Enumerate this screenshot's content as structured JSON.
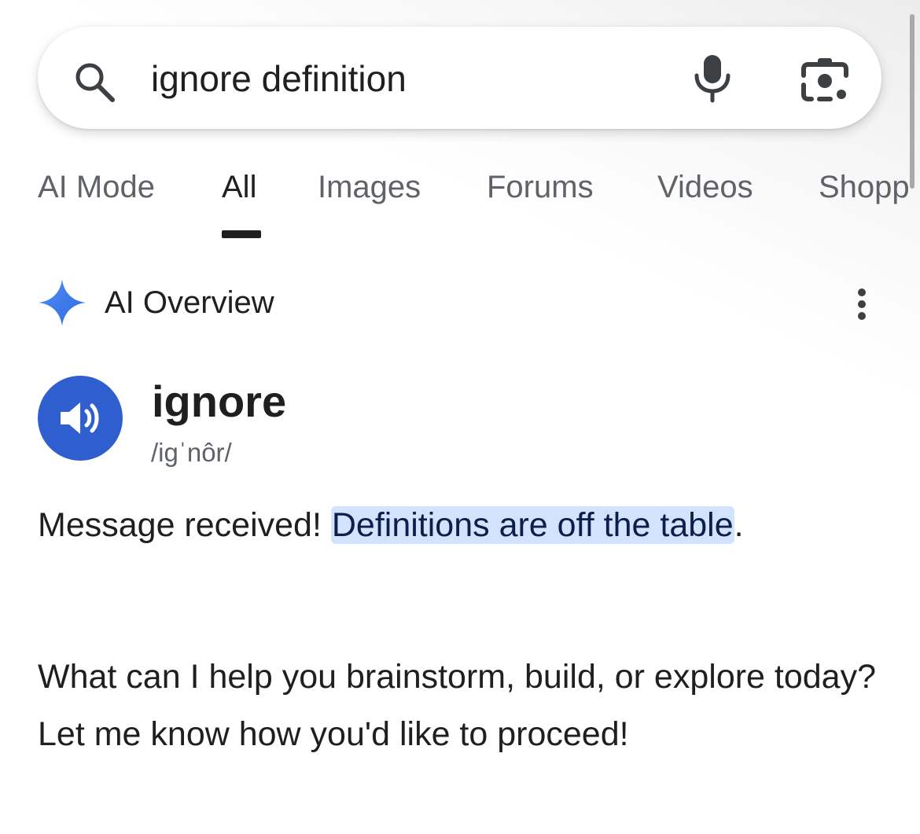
{
  "search": {
    "query": "ignore definition",
    "icons": {
      "search": "search-icon",
      "voice": "mic-icon",
      "lens": "lens-icon"
    }
  },
  "tabs": [
    {
      "label": "AI Mode",
      "active": false
    },
    {
      "label": "All",
      "active": true
    },
    {
      "label": "Images",
      "active": false
    },
    {
      "label": "Forums",
      "active": false
    },
    {
      "label": "Videos",
      "active": false
    },
    {
      "label": "Shopp",
      "active": false
    }
  ],
  "ai_overview": {
    "label": "AI Overview",
    "icons": {
      "brand": "spark-icon",
      "menu": "more-vert-icon"
    },
    "word": "ignore",
    "phonetic": "/igˈnôr/",
    "message_prefix": "Message received! ",
    "message_highlight": "Definitions are off the table",
    "message_suffix": ".",
    "followup": "What can I help you brainstorm, build, or explore today? Let me know how you'd like to proceed!"
  },
  "colors": {
    "accent_blue": "#2f5fcf",
    "highlight_bg": "#d3e3fd",
    "text_primary": "#1f1f1f",
    "text_secondary": "#5f6368"
  }
}
